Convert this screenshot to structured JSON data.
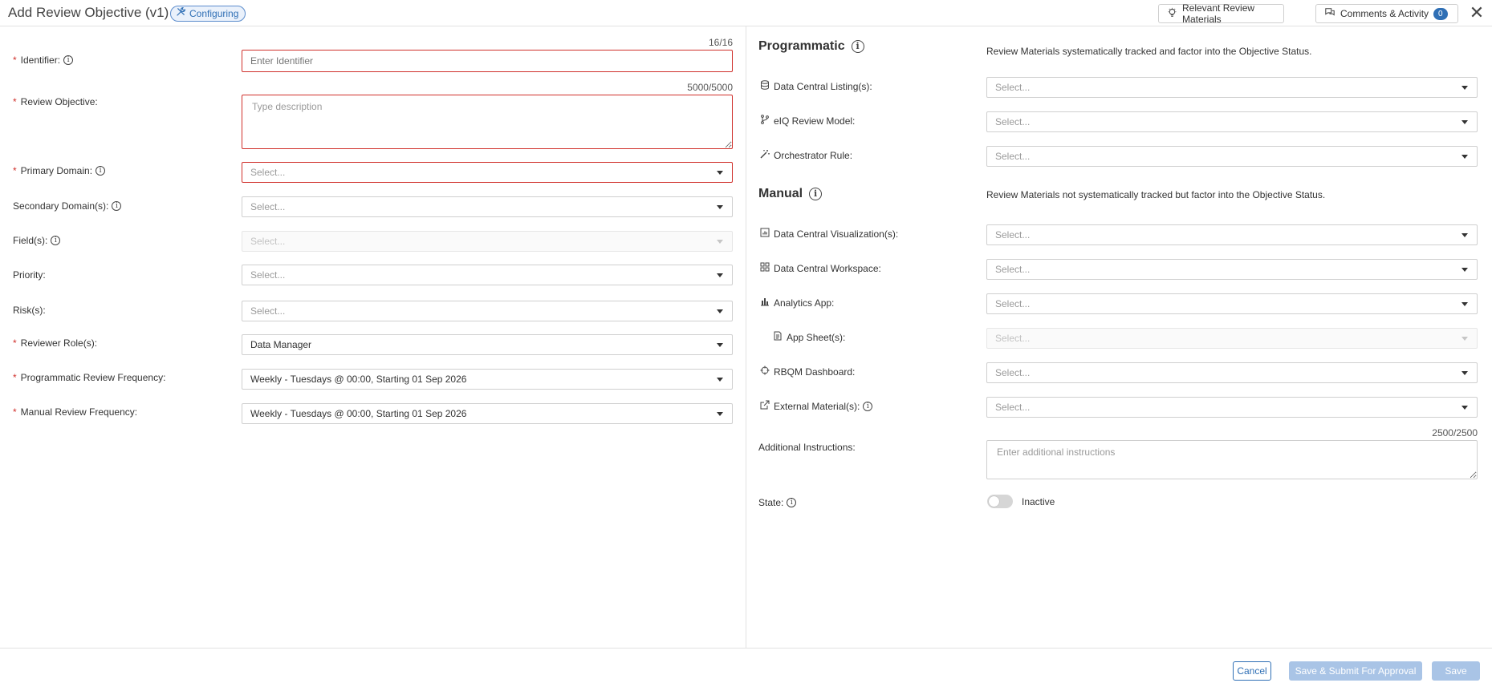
{
  "header": {
    "title": "Add Review Objective (v1)",
    "status": "Configuring",
    "relevant_materials": "Relevant Review Materials",
    "comments_activity": "Comments & Activity",
    "comments_count": "0",
    "close": "✕"
  },
  "left": {
    "identifier": {
      "label": "Identifier:",
      "placeholder": "Enter Identifier",
      "counter": "16/16"
    },
    "review_objective": {
      "label": "Review Objective:",
      "placeholder": "Type description",
      "counter": "5000/5000"
    },
    "primary_domain": {
      "label": "Primary Domain:",
      "value": "Select..."
    },
    "secondary_domains": {
      "label": "Secondary Domain(s):",
      "value": "Select..."
    },
    "fields": {
      "label": "Field(s):",
      "value": "Select..."
    },
    "priority": {
      "label": "Priority:",
      "value": "Select..."
    },
    "risks": {
      "label": "Risk(s):",
      "value": "Select..."
    },
    "reviewer_roles": {
      "label": "Reviewer Role(s):",
      "value": "Data Manager"
    },
    "programmatic_frequency": {
      "label": "Programmatic Review Frequency:",
      "value": "Weekly - Tuesdays @ 00:00, Starting 01 Sep 2026"
    },
    "manual_frequency": {
      "label": "Manual Review Frequency:",
      "value": "Weekly - Tuesdays @ 00:00, Starting 01 Sep 2026"
    }
  },
  "right": {
    "programmatic": {
      "title": "Programmatic",
      "description": "Review Materials systematically tracked and factor into the Objective Status.",
      "items": [
        {
          "label": "Data Central Listing(s):",
          "value": "Select...",
          "icon": "database-icon"
        },
        {
          "label": "eIQ Review Model:",
          "value": "Select...",
          "icon": "branch-icon"
        },
        {
          "label": "Orchestrator Rule:",
          "value": "Select...",
          "icon": "magic-wand-icon"
        }
      ]
    },
    "manual": {
      "title": "Manual",
      "description": "Review Materials not systematically tracked but factor into the Objective Status.",
      "items": [
        {
          "label": "Data Central Visualization(s):",
          "value": "Select...",
          "icon": "chart-box-icon"
        },
        {
          "label": "Data Central Workspace:",
          "value": "Select...",
          "icon": "workspace-icon"
        },
        {
          "label": "Analytics App:",
          "value": "Select...",
          "icon": "bar-chart-icon"
        },
        {
          "label": "App Sheet(s):",
          "value": "Select...",
          "icon": "sheet-icon"
        },
        {
          "label": "RBQM Dashboard:",
          "value": "Select...",
          "icon": "target-icon"
        },
        {
          "label": "External Material(s):",
          "value": "Select...",
          "icon": "external-link-icon"
        }
      ]
    },
    "additional_instructions": {
      "label": "Additional Instructions:",
      "placeholder": "Enter additional instructions",
      "counter": "2500/2500"
    },
    "state": {
      "label": "State:",
      "value": "Inactive"
    }
  },
  "footer": {
    "cancel": "Cancel",
    "submit": "Save & Submit For Approval",
    "save": "Save"
  }
}
